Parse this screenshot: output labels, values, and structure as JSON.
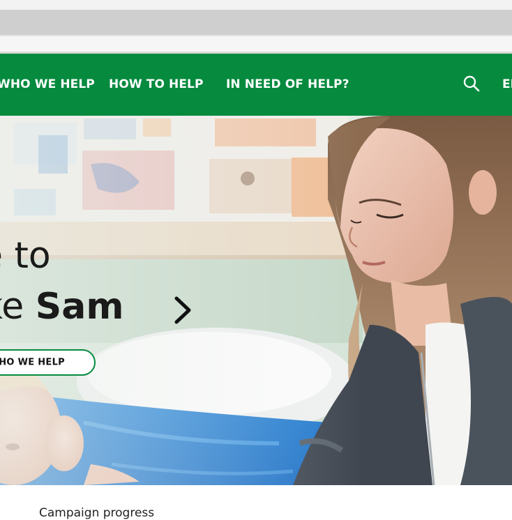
{
  "nav": {
    "items": [
      "WHO WE HELP",
      "HOW TO HELP",
      "IN NEED OF HELP?"
    ],
    "search_icon": "search-icon",
    "language": "EN"
  },
  "hero": {
    "headline_line1": "e to",
    "headline_line2_prefix": "ke ",
    "headline_line2_bold": "Sam",
    "arrow_icon": "chevron-right-icon",
    "button_label": "WHO WE HELP"
  },
  "below": {
    "campaign_text": "Campaign progress"
  },
  "colors": {
    "brand_green": "#058a3e",
    "text_dark": "#1a1a1a"
  }
}
